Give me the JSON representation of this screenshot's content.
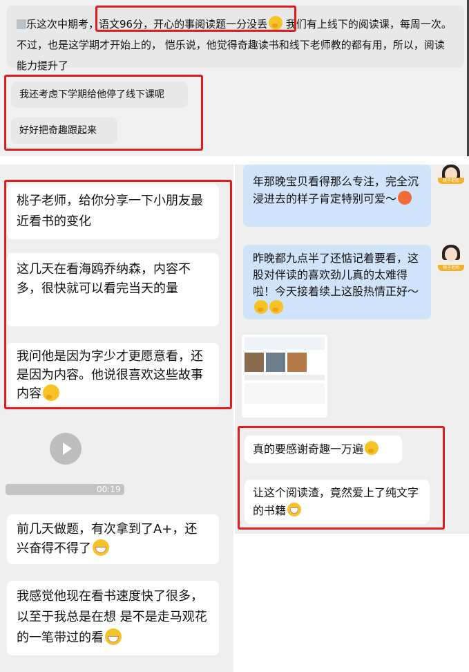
{
  "top_panel": {
    "first_message": {
      "prefix": "乐这次中期考，",
      "highlight": "语文96分，开心的事阅读题一分没丢",
      "rest": "我们有上线下的阅读课，每周一次。 不过，也是这学期才开始上的， 恺乐说，他觉得奇趣读书和线下老师教的都有用，所以，阅读能力提升了"
    },
    "second_message": "我还考虑下学期给他停了线下课呢",
    "third_message": "好好把奇趣跟起来"
  },
  "left_panel": {
    "messages": [
      "桃子老师，给你分享一下小朋友最近看书的变化",
      "这几天在看海鸥乔纳森，内容不多，很快就可以看完当天的量",
      "我问他是因为字少才更愿意看，还是因为内容。他说很喜欢这些故事内容"
    ],
    "video_duration": "00:19",
    "messages_2": [
      "前几天做题，有次拿到了A+，还兴奋得不得了",
      "我感觉他现在看书速度快了很多，以至于我总是在想 是不是走马观花的一笔带过的看"
    ]
  },
  "right_panel": {
    "messages": [
      "年那晚宝贝看得那么专注，完全沉浸进去的样子肯定特别可爱～",
      "昨晚都九点半了还惦记着要看，这股对伴读的喜欢劲儿真的太难得啦！今天接着续上这股热情正好～"
    ],
    "avatar_tag": "桃子老师",
    "messages_2": [
      "真的要感谢奇趣一万遍",
      "让这个阅读渣，竟然爱上了纯文字的书籍"
    ]
  },
  "colors": {
    "highlight_border": "#e21c1c",
    "teacher_bubble": "#cfe4fb",
    "panel_bg": "#efefef"
  }
}
